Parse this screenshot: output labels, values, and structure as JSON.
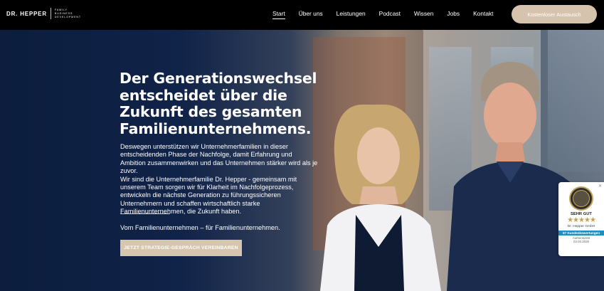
{
  "brand": {
    "name": "DR. HEPPER",
    "subtitle_lines": [
      "FAMILY",
      "BUSINESS",
      "DEVELOPMENT"
    ]
  },
  "nav": {
    "items": [
      {
        "label": "Start",
        "active": true
      },
      {
        "label": "Über uns"
      },
      {
        "label": "Leistungen"
      },
      {
        "label": "Podcast"
      },
      {
        "label": "Wissen"
      },
      {
        "label": "Jobs"
      },
      {
        "label": "Kontakt"
      }
    ],
    "cta_label": "Kostenloser Austausch"
  },
  "hero": {
    "headline": "Der Generationswechsel entscheidet über die Zukunft des gesamten Familienunternehmens.",
    "paragraph1": "Deswegen unterstützen wir Unternehmerfamilien in dieser entscheidenden Phase der Nachfolge, damit Erfahrung und Ambition zusammenwirken und das Unternehmen stärker wird als je zuvor.",
    "paragraph2": "Wir sind die Unternehmerfamilie Dr. Hepper - gemeinsam mit unserem Team sorgen wir für Klarheit im Nachfolgeprozess, entwickeln die nächste Generation zu führungssicheren Unternehmern und schaffen wirtschaftlich starke Familienunternehmen, die Zukunft haben.",
    "tagline": "Vom Familienunternehmen – für Familienunternehmen.",
    "cta_label": "JETZT STRATEGIE-GESPRÄCH VEREINBAREN"
  },
  "badge": {
    "seal_text": "Proven Expert",
    "rating_word": "SEHR GUT",
    "stars": "★★★★★",
    "company": "Dr. Hepper GmbH",
    "reviews": "67 Kundenbewertungen",
    "auth_label": "Authentizität",
    "date": "02.03.2026"
  },
  "colors": {
    "nav_bg": "#000000",
    "accent_beige": "#d5c3ad",
    "hero_navy": "#0c1d3d"
  }
}
